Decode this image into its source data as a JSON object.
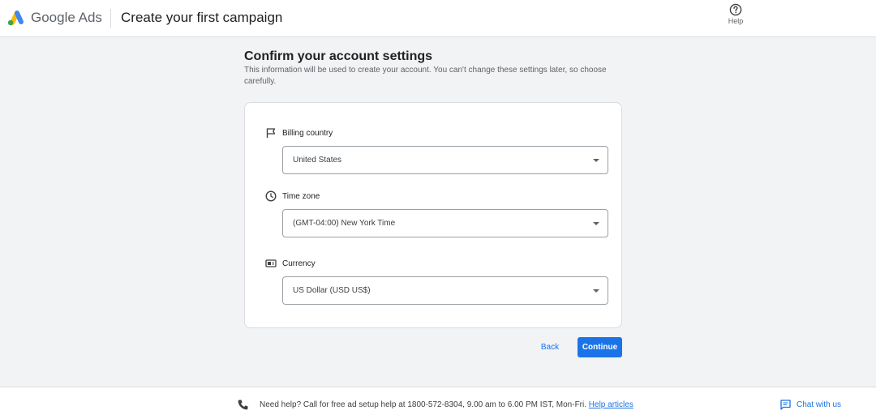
{
  "header": {
    "brand": "Google Ads",
    "page_title": "Create your first campaign",
    "help_label": "Help"
  },
  "main": {
    "heading": "Confirm your account settings",
    "description": "This information will be used to create your account. You can't change these settings later, so choose carefully.",
    "fields": [
      {
        "label": "Billing country",
        "value": "United States",
        "icon": "flag-icon"
      },
      {
        "label": "Time zone",
        "value": "(GMT-04:00) New York Time",
        "icon": "clock-icon"
      },
      {
        "label": "Currency",
        "value": "US Dollar (USD US$)",
        "icon": "currency-icon"
      }
    ],
    "back_label": "Back",
    "continue_label": "Continue"
  },
  "footer": {
    "help_text": "Need help? Call for free ad setup help at 1800-572-8304, 9.00 am to 6.00 PM IST, Mon-Fri.",
    "help_link": "Help articles",
    "chat_label": "Chat with us"
  },
  "colors": {
    "accent": "#1a73e8",
    "background": "#f1f3f4",
    "logo_blue": "#4285f4",
    "logo_yellow": "#fbbc04",
    "logo_green": "#34a853"
  }
}
